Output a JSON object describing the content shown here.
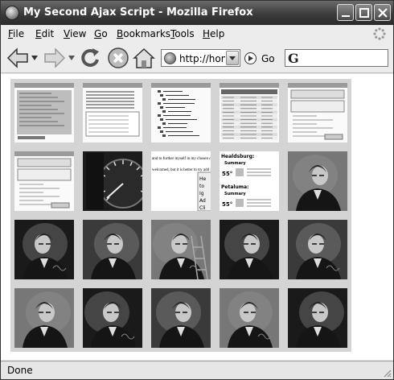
{
  "window": {
    "title": "My Second Ajax Script - Mozilla Firefox"
  },
  "menubar": {
    "items": [
      {
        "accel": "F",
        "rest": "ile"
      },
      {
        "accel": "E",
        "rest": "dit"
      },
      {
        "accel": "V",
        "rest": "iew"
      },
      {
        "accel": "G",
        "rest": "o"
      },
      {
        "accel": "B",
        "rest": "ookmarks"
      },
      {
        "accel": "T",
        "rest": "ools"
      },
      {
        "accel": "H",
        "rest": "elp"
      }
    ]
  },
  "navbar": {
    "url_value": "http://hom",
    "go_label": "Go",
    "search_engine_glyph": "G",
    "search_value": ""
  },
  "thumbnails": [
    {
      "kind": "screenshot-form",
      "desc": "screenshot"
    },
    {
      "kind": "screenshot-list",
      "desc": "screenshot"
    },
    {
      "kind": "screenshot-filetree",
      "desc": "screenshot"
    },
    {
      "kind": "screenshot-table",
      "desc": "screenshot"
    },
    {
      "kind": "screenshot-dialog",
      "desc": "screenshot"
    },
    {
      "kind": "screenshot-dialog2",
      "desc": "screenshot"
    },
    {
      "kind": "gauge",
      "desc": "photo"
    },
    {
      "kind": "text-popup",
      "desc": "screenshot",
      "lines": [
        "and to further myself in my chosen d",
        "welcomed, but it is better to try add fal th"
      ],
      "menu": [
        "He",
        "to",
        "Ig",
        "Ad",
        "Cli"
      ]
    },
    {
      "kind": "weather",
      "desc": "screenshot",
      "lines": [
        "Healdsburg:",
        "Summary",
        "55°",
        "Petaluma:",
        "Summary",
        "55°"
      ]
    },
    {
      "kind": "portrait",
      "desc": "photo"
    },
    {
      "kind": "portrait",
      "desc": "photo"
    },
    {
      "kind": "portrait",
      "desc": "photo"
    },
    {
      "kind": "portrait-ladder",
      "desc": "photo"
    },
    {
      "kind": "portrait",
      "desc": "photo"
    },
    {
      "kind": "portrait",
      "desc": "photo"
    },
    {
      "kind": "portrait",
      "desc": "photo"
    },
    {
      "kind": "portrait",
      "desc": "photo"
    },
    {
      "kind": "portrait",
      "desc": "photo"
    },
    {
      "kind": "portrait",
      "desc": "photo"
    },
    {
      "kind": "portrait",
      "desc": "photo"
    }
  ],
  "statusbar": {
    "text": "Done"
  }
}
